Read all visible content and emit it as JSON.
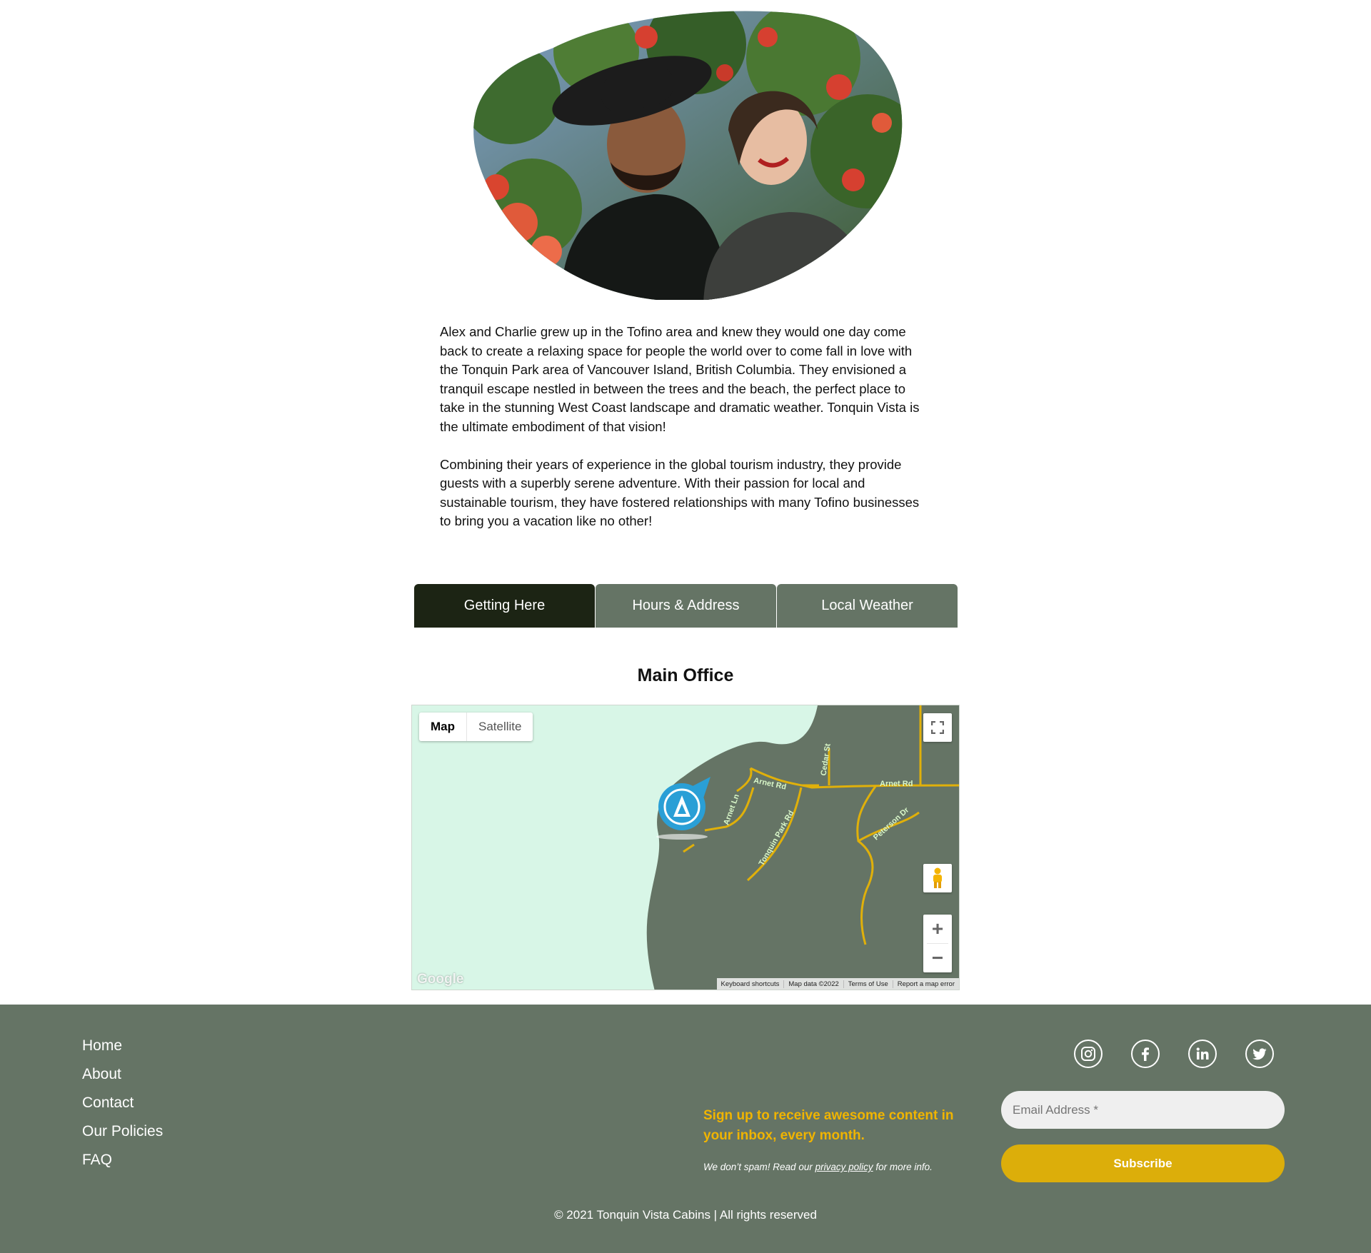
{
  "about": {
    "photo_alt": "Alex and Charlie",
    "paragraphs": [
      "Alex and Charlie grew up in the Tofino area and knew they would one day come back to create a relaxing space for people the world over to come fall in love with the Tonquin Park area of Vancouver Island, British Columbia. They envisioned a tranquil escape nestled in between the trees and the beach, the perfect place to take in the stunning West Coast landscape and dramatic weather. Tonquin Vista is the ultimate embodiment of that vision!",
      "Combining their years of experience in the global tourism industry, they provide guests with a superbly serene adventure. With their passion for local and sustainable tourism, they have fostered relationships with many Tofino businesses to bring you a vacation like no other!"
    ]
  },
  "tabs": [
    {
      "label": "Getting Here",
      "active": true
    },
    {
      "label": "Hours & Address",
      "active": false
    },
    {
      "label": "Local Weather",
      "active": false
    }
  ],
  "section": {
    "title": "Main Office"
  },
  "map": {
    "type_buttons": [
      "Map",
      "Satellite"
    ],
    "selected_type": "Map",
    "roads": [
      "Arnet Rd",
      "Arnet Rd",
      "Cedar St",
      "Arnet Ln",
      "Tonquin Park Rd",
      "Peterson Dr"
    ],
    "google_logo": "Google",
    "attribution": [
      "Keyboard shortcuts",
      "Map data ©2022",
      "Terms of Use",
      "Report a map error"
    ],
    "colors": {
      "water": "#d8f6e7",
      "land": "#657465",
      "road": "#e0b00a",
      "marker": "#2a9fd6"
    }
  },
  "footer": {
    "nav": [
      "Home",
      "About",
      "Contact",
      "Our Policies",
      "FAQ"
    ],
    "socials": [
      "instagram-icon",
      "facebook-icon",
      "linkedin-icon",
      "twitter-icon"
    ],
    "signup_text": "Sign up to receive awesome content in your inbox, every month.",
    "nospam_before": "We don’t spam! Read our ",
    "nospam_link": "privacy policy",
    "nospam_after": " for more info.",
    "email_placeholder": "Email Address *",
    "subscribe_label": "Subscribe",
    "copyright": "© 2021 Tonquin Vista Cabins | All rights reserved",
    "colors": {
      "background": "#657465",
      "accent": "#dcae0a",
      "signup_text": "#f0b400"
    }
  }
}
